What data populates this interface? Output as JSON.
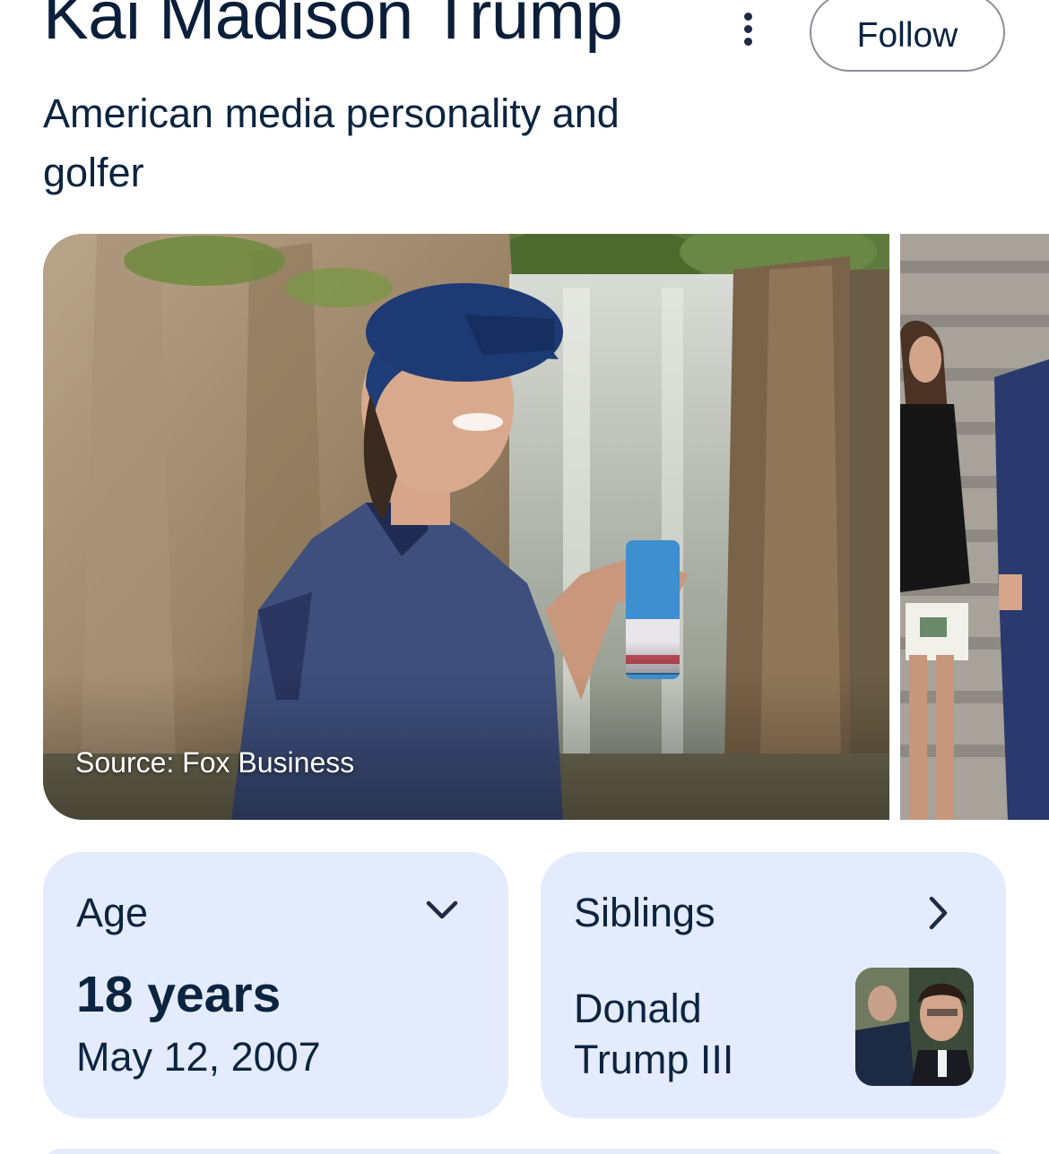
{
  "header": {
    "title": "Kai Madison Trump",
    "subtitle": "American media personality and golfer",
    "follow_label": "Follow",
    "more_icon": "more-vert-icon"
  },
  "images": {
    "main_source": "Source: Fox Business"
  },
  "cards": {
    "age": {
      "label": "Age",
      "value": "18 years",
      "date": "May 12, 2007",
      "icon": "chevron-down-icon"
    },
    "siblings": {
      "label": "Siblings",
      "name": "Donald Trump III",
      "icon": "chevron-right-icon"
    }
  },
  "colors": {
    "card_bg": "#e4ebfd",
    "text": "#0b2440",
    "follow_border": "#8a8f98"
  }
}
